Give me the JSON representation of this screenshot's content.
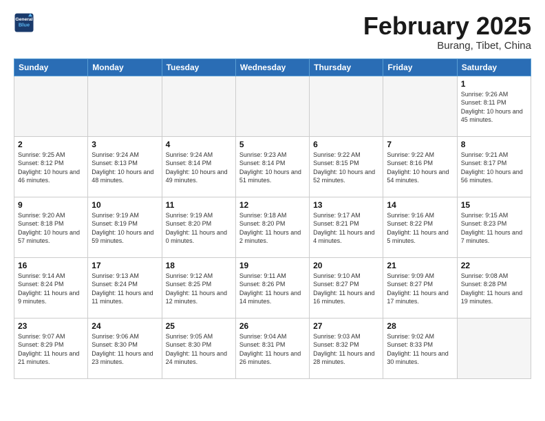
{
  "logo": {
    "line1": "General",
    "line2": "Blue"
  },
  "title": "February 2025",
  "subtitle": "Burang, Tibet, China",
  "weekdays": [
    "Sunday",
    "Monday",
    "Tuesday",
    "Wednesday",
    "Thursday",
    "Friday",
    "Saturday"
  ],
  "weeks": [
    [
      {
        "day": "",
        "info": ""
      },
      {
        "day": "",
        "info": ""
      },
      {
        "day": "",
        "info": ""
      },
      {
        "day": "",
        "info": ""
      },
      {
        "day": "",
        "info": ""
      },
      {
        "day": "",
        "info": ""
      },
      {
        "day": "1",
        "info": "Sunrise: 9:26 AM\nSunset: 8:11 PM\nDaylight: 10 hours\nand 45 minutes."
      }
    ],
    [
      {
        "day": "2",
        "info": "Sunrise: 9:25 AM\nSunset: 8:12 PM\nDaylight: 10 hours\nand 46 minutes."
      },
      {
        "day": "3",
        "info": "Sunrise: 9:24 AM\nSunset: 8:13 PM\nDaylight: 10 hours\nand 48 minutes."
      },
      {
        "day": "4",
        "info": "Sunrise: 9:24 AM\nSunset: 8:14 PM\nDaylight: 10 hours\nand 49 minutes."
      },
      {
        "day": "5",
        "info": "Sunrise: 9:23 AM\nSunset: 8:14 PM\nDaylight: 10 hours\nand 51 minutes."
      },
      {
        "day": "6",
        "info": "Sunrise: 9:22 AM\nSunset: 8:15 PM\nDaylight: 10 hours\nand 52 minutes."
      },
      {
        "day": "7",
        "info": "Sunrise: 9:22 AM\nSunset: 8:16 PM\nDaylight: 10 hours\nand 54 minutes."
      },
      {
        "day": "8",
        "info": "Sunrise: 9:21 AM\nSunset: 8:17 PM\nDaylight: 10 hours\nand 56 minutes."
      }
    ],
    [
      {
        "day": "9",
        "info": "Sunrise: 9:20 AM\nSunset: 8:18 PM\nDaylight: 10 hours\nand 57 minutes."
      },
      {
        "day": "10",
        "info": "Sunrise: 9:19 AM\nSunset: 8:19 PM\nDaylight: 10 hours\nand 59 minutes."
      },
      {
        "day": "11",
        "info": "Sunrise: 9:19 AM\nSunset: 8:20 PM\nDaylight: 11 hours\nand 0 minutes."
      },
      {
        "day": "12",
        "info": "Sunrise: 9:18 AM\nSunset: 8:20 PM\nDaylight: 11 hours\nand 2 minutes."
      },
      {
        "day": "13",
        "info": "Sunrise: 9:17 AM\nSunset: 8:21 PM\nDaylight: 11 hours\nand 4 minutes."
      },
      {
        "day": "14",
        "info": "Sunrise: 9:16 AM\nSunset: 8:22 PM\nDaylight: 11 hours\nand 5 minutes."
      },
      {
        "day": "15",
        "info": "Sunrise: 9:15 AM\nSunset: 8:23 PM\nDaylight: 11 hours\nand 7 minutes."
      }
    ],
    [
      {
        "day": "16",
        "info": "Sunrise: 9:14 AM\nSunset: 8:24 PM\nDaylight: 11 hours\nand 9 minutes."
      },
      {
        "day": "17",
        "info": "Sunrise: 9:13 AM\nSunset: 8:24 PM\nDaylight: 11 hours\nand 11 minutes."
      },
      {
        "day": "18",
        "info": "Sunrise: 9:12 AM\nSunset: 8:25 PM\nDaylight: 11 hours\nand 12 minutes."
      },
      {
        "day": "19",
        "info": "Sunrise: 9:11 AM\nSunset: 8:26 PM\nDaylight: 11 hours\nand 14 minutes."
      },
      {
        "day": "20",
        "info": "Sunrise: 9:10 AM\nSunset: 8:27 PM\nDaylight: 11 hours\nand 16 minutes."
      },
      {
        "day": "21",
        "info": "Sunrise: 9:09 AM\nSunset: 8:27 PM\nDaylight: 11 hours\nand 17 minutes."
      },
      {
        "day": "22",
        "info": "Sunrise: 9:08 AM\nSunset: 8:28 PM\nDaylight: 11 hours\nand 19 minutes."
      }
    ],
    [
      {
        "day": "23",
        "info": "Sunrise: 9:07 AM\nSunset: 8:29 PM\nDaylight: 11 hours\nand 21 minutes."
      },
      {
        "day": "24",
        "info": "Sunrise: 9:06 AM\nSunset: 8:30 PM\nDaylight: 11 hours\nand 23 minutes."
      },
      {
        "day": "25",
        "info": "Sunrise: 9:05 AM\nSunset: 8:30 PM\nDaylight: 11 hours\nand 24 minutes."
      },
      {
        "day": "26",
        "info": "Sunrise: 9:04 AM\nSunset: 8:31 PM\nDaylight: 11 hours\nand 26 minutes."
      },
      {
        "day": "27",
        "info": "Sunrise: 9:03 AM\nSunset: 8:32 PM\nDaylight: 11 hours\nand 28 minutes."
      },
      {
        "day": "28",
        "info": "Sunrise: 9:02 AM\nSunset: 8:33 PM\nDaylight: 11 hours\nand 30 minutes."
      },
      {
        "day": "",
        "info": ""
      }
    ]
  ]
}
